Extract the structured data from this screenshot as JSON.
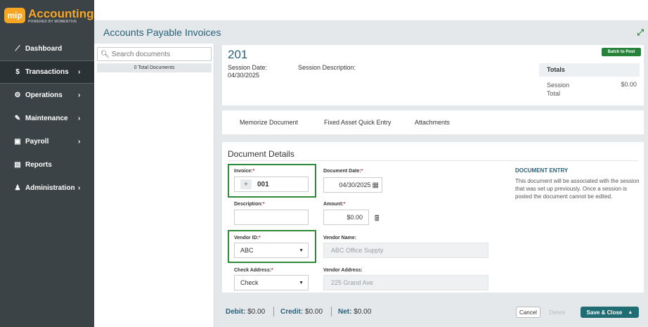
{
  "app": {
    "logo_badge": "mip",
    "logo_title": "Accounting",
    "logo_subtitle": "POWERED BY MOMENTIVE",
    "brand_color": "#f6a623",
    "accent_color": "#27607a"
  },
  "sidebar": {
    "items": [
      {
        "label": "Dashboard",
        "icon": "chart-line-icon",
        "glyph": "⟋",
        "chevron": false,
        "active": false
      },
      {
        "label": "Transactions",
        "icon": "dollar-icon",
        "glyph": "$",
        "chevron": true,
        "active": true
      },
      {
        "label": "Operations",
        "icon": "gears-icon",
        "glyph": "⚙",
        "chevron": true,
        "active": false
      },
      {
        "label": "Maintenance",
        "icon": "wrench-icon",
        "glyph": "✎",
        "chevron": true,
        "active": false
      },
      {
        "label": "Payroll",
        "icon": "money-icon",
        "glyph": "▣",
        "chevron": true,
        "active": false
      },
      {
        "label": "Reports",
        "icon": "report-icon",
        "glyph": "▤",
        "chevron": false,
        "active": false
      },
      {
        "label": "Administration",
        "icon": "users-icon",
        "glyph": "♟",
        "chevron": true,
        "active": false
      }
    ],
    "chevron_glyph": "›"
  },
  "page": {
    "title": "Accounts Payable Invoices",
    "expand_glyph": "⤢"
  },
  "left_panel": {
    "search_placeholder": "Search documents",
    "total_documents": "0 Total Documents"
  },
  "session": {
    "number": "201",
    "date_label": "Session Date:",
    "date_value": "04/30/2025",
    "description_label": "Session Description:",
    "batch_button": "Batch to Post",
    "totals_header": "Totals",
    "totals_row_label": "Session Total",
    "totals_row_value": "$0.00"
  },
  "tabs": [
    "Memorize Document",
    "Fixed Asset Quick Entry",
    "Attachments"
  ],
  "document_details": {
    "title": "Document Details",
    "invoice_label": "Invoice:",
    "invoice_value": "001",
    "document_date_label": "Document Date:",
    "document_date_value": "04/30/2025",
    "description_label": "Description:",
    "description_value": "",
    "amount_label": "Amount:",
    "amount_value": "$0.00",
    "vendor_id_label": "Vendor ID:",
    "vendor_id_value": "ABC",
    "vendor_name_label": "Vendor Name:",
    "vendor_name_value": "ABC Office Supply",
    "check_address_label": "Check Address:",
    "check_address_value": "Check",
    "vendor_address_label": "Vendor Address:",
    "vendor_address_value": "225 Grand Ave",
    "required_mark": "*"
  },
  "doc_entry": {
    "title": "DOCUMENT ENTRY",
    "text": "This document will be associated with the session that was set up previously. Once a session is posted the document cannot be edited."
  },
  "footer": {
    "debit_label": "Debit:",
    "debit_value": "$0.00",
    "credit_label": "Credit:",
    "credit_value": "$0.00",
    "net_label": "Net:",
    "net_value": "$0.00",
    "cancel": "Cancel",
    "delete": "Delete",
    "save_close": "Save & Close"
  }
}
